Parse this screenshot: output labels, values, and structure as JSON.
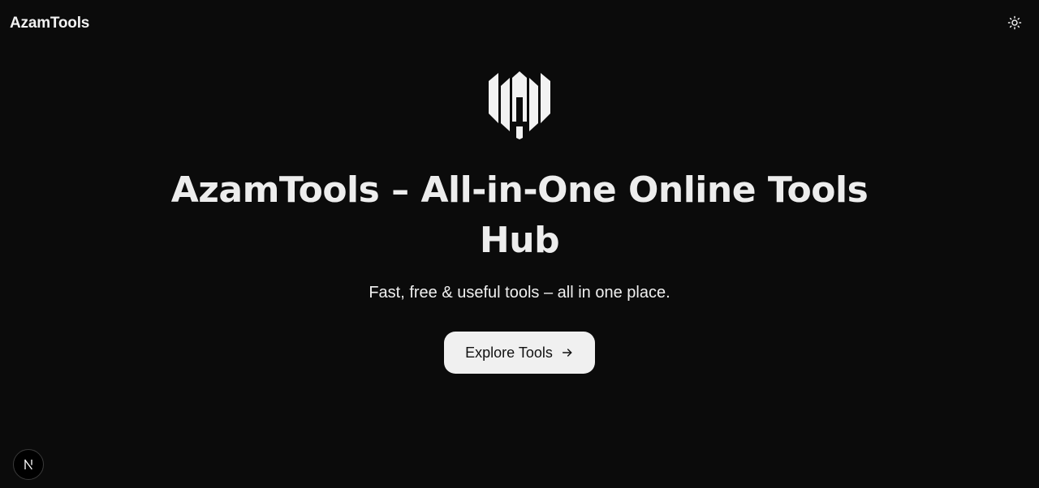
{
  "header": {
    "brand": "AzamTools",
    "theme_toggle_icon": "sun-icon"
  },
  "hero": {
    "logo_icon": "azamtools-logo",
    "title": "AzamTools – All-in-One Online Tools Hub",
    "subtitle": "Fast, free & useful tools – all in one place.",
    "cta_label": "Explore Tools",
    "cta_icon": "arrow-right-icon"
  },
  "dev_badge": {
    "icon": "nextjs-icon"
  },
  "colors": {
    "background": "#0b0b0b",
    "text": "#ededed",
    "button_bg": "#f0f0f0",
    "button_text": "#111111"
  }
}
